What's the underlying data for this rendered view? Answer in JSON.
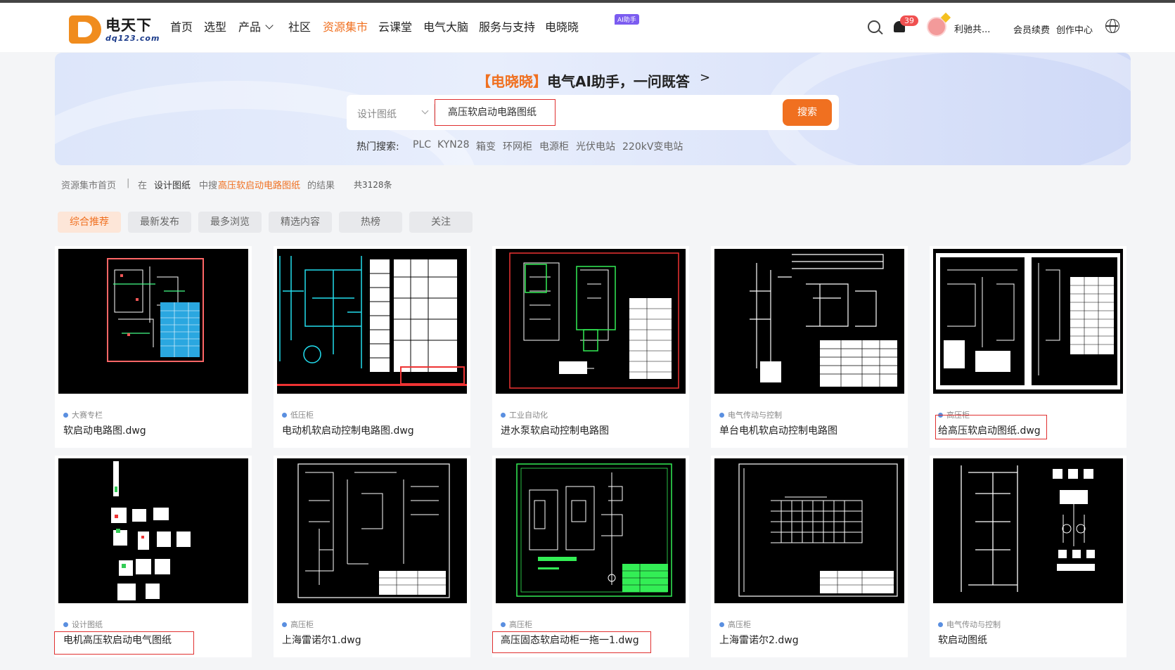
{
  "header": {
    "logo_name": "电天下",
    "logo_sub": "dq123.com",
    "nav": [
      "首页",
      "选型",
      "产品",
      "社区",
      "资源集市",
      "云课堂",
      "电气大脑",
      "服务与支持",
      "电晓晓"
    ],
    "active_nav": "资源集市",
    "ai_badge": "AI助手",
    "notification_count": "39",
    "user_name": "利驰共...",
    "member_label": "会员续费",
    "creator_label": "创作中心"
  },
  "banner": {
    "ai_bracket": "【电晓晓】",
    "ai_text": "电气AI助手，一问既答",
    "ai_arrow": ">",
    "search": {
      "category": "设计图纸",
      "query": "高压软启动电路图纸",
      "button": "搜索"
    },
    "hot_label": "热门搜索:",
    "hot_items": [
      "PLC",
      "KYN28",
      "箱变",
      "环网柜",
      "电源柜",
      "光伏电站",
      "220kV变电站"
    ]
  },
  "breadcrumb": {
    "home": "资源集市首页",
    "sep": "|",
    "in": "在",
    "category": "设计图纸",
    "mid": "中搜",
    "keyword": "高压软启动电路图纸",
    "suffix": "的结果",
    "count": "共3128条"
  },
  "tabs": [
    "综合推荐",
    "最新发布",
    "最多浏览",
    "精选内容",
    "热榜",
    "关注"
  ],
  "active_tab": "综合推荐",
  "cards": [
    {
      "tag": "大赛专栏",
      "title": "软启动电路图.dwg",
      "highlight": false
    },
    {
      "tag": "低压柜",
      "title": "电动机软启动控制电路图.dwg",
      "highlight": false
    },
    {
      "tag": "工业自动化",
      "title": "进水泵软启动控制电路图",
      "highlight": false
    },
    {
      "tag": "电气传动与控制",
      "title": "单台电机软启动控制电路图",
      "highlight": false
    },
    {
      "tag": "高压柜",
      "title": "给高压软启动图纸.dwg",
      "highlight": true
    },
    {
      "tag": "设计图纸",
      "title": "电机高压软启动电气图纸",
      "highlight": true
    },
    {
      "tag": "高压柜",
      "title": "上海雷诺尔1.dwg",
      "highlight": false
    },
    {
      "tag": "高压柜",
      "title": "高压固态软启动柜一拖一1.dwg",
      "highlight": true
    },
    {
      "tag": "高压柜",
      "title": "上海雷诺尔2.dwg",
      "highlight": false
    },
    {
      "tag": "电气传动与控制",
      "title": "软启动图纸",
      "highlight": false
    }
  ],
  "colors": {
    "accent": "#f07020",
    "highlight_box": "#e03030",
    "tag_dot": "#5a8fe0"
  }
}
